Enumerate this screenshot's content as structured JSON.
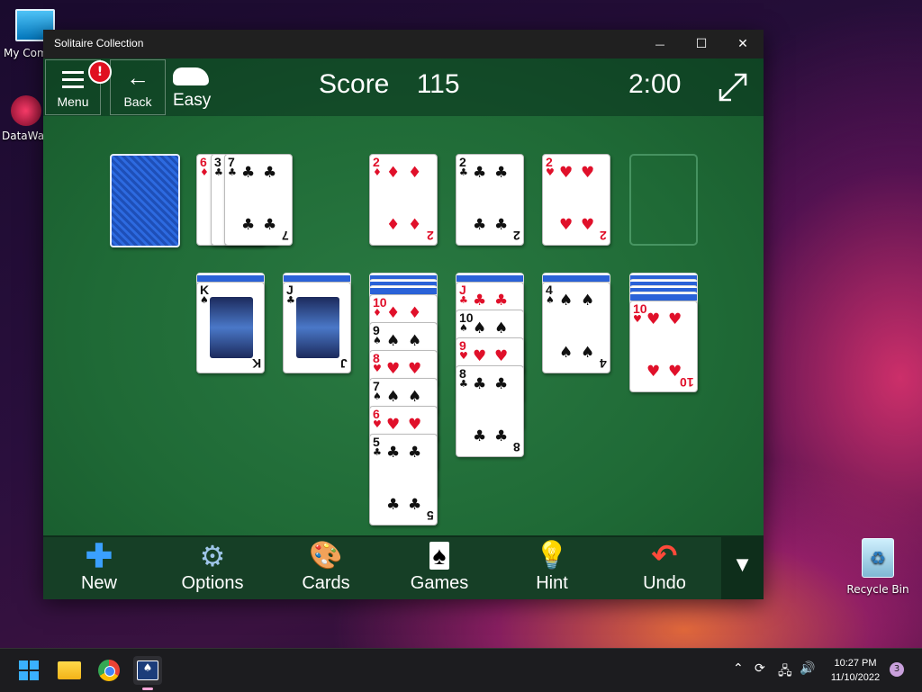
{
  "desktop": {
    "icons": [
      {
        "label": "My Com"
      },
      {
        "label": "DataWag"
      },
      {
        "label": "Recycle Bin"
      }
    ]
  },
  "window": {
    "title": "Solitaire Collection",
    "controls": {
      "minimize": "—",
      "maximize": "☐",
      "close": "✕"
    }
  },
  "header": {
    "menu_label": "Menu",
    "alert_badge": "!",
    "back_label": "Back",
    "difficulty": "Easy",
    "score_label": "Score",
    "score_value": "115",
    "timer": "2:00"
  },
  "stock": {
    "waste": [
      {
        "rank": "6",
        "suit": "♦",
        "color": "red"
      },
      {
        "rank": "3",
        "suit": "♣",
        "color": "black"
      },
      {
        "rank": "7",
        "suit": "♣",
        "color": "black"
      }
    ]
  },
  "foundations": [
    {
      "rank": "2",
      "suit": "♦",
      "color": "red"
    },
    {
      "rank": "2",
      "suit": "♣",
      "color": "black"
    },
    {
      "rank": "2",
      "suit": "♥",
      "color": "red"
    },
    {
      "rank": "",
      "suit": "",
      "color": ""
    }
  ],
  "tableau": [
    {
      "hidden": 1,
      "cards": [
        {
          "rank": "K",
          "suit": "♠",
          "color": "black"
        }
      ]
    },
    {
      "hidden": 1,
      "cards": [
        {
          "rank": "J",
          "suit": "♣",
          "color": "black"
        }
      ]
    },
    {
      "hidden": 3,
      "cards": [
        {
          "rank": "10",
          "suit": "♦",
          "color": "red"
        },
        {
          "rank": "9",
          "suit": "♠",
          "color": "black"
        },
        {
          "rank": "8",
          "suit": "♥",
          "color": "red"
        },
        {
          "rank": "7",
          "suit": "♠",
          "color": "black"
        },
        {
          "rank": "6",
          "suit": "♥",
          "color": "red"
        },
        {
          "rank": "5",
          "suit": "♣",
          "color": "black"
        }
      ]
    },
    {
      "hidden": 1,
      "cards": [
        {
          "rank": "J",
          "suit": "♣",
          "color": "red"
        },
        {
          "rank": "10",
          "suit": "♠",
          "color": "black"
        },
        {
          "rank": "9",
          "suit": "♥",
          "color": "red"
        },
        {
          "rank": "8",
          "suit": "♣",
          "color": "black"
        }
      ]
    },
    {
      "hidden": 1,
      "cards": [
        {
          "rank": "4",
          "suit": "♠",
          "color": "black"
        }
      ]
    },
    {
      "hidden": 4,
      "cards": [
        {
          "rank": "10",
          "suit": "♥",
          "color": "red"
        }
      ]
    }
  ],
  "toolbar": {
    "items": [
      {
        "label": "New",
        "icon": "plus-icon"
      },
      {
        "label": "Options",
        "icon": "gear-icon"
      },
      {
        "label": "Cards",
        "icon": "palette-icon"
      },
      {
        "label": "Games",
        "icon": "cards-icon"
      },
      {
        "label": "Hint",
        "icon": "lightbulb-icon"
      },
      {
        "label": "Undo",
        "icon": "undo-icon"
      }
    ],
    "expand_icon": "▼"
  },
  "taskbar": {
    "time": "10:27 PM",
    "date": "11/10/2022",
    "notification_count": "3"
  }
}
